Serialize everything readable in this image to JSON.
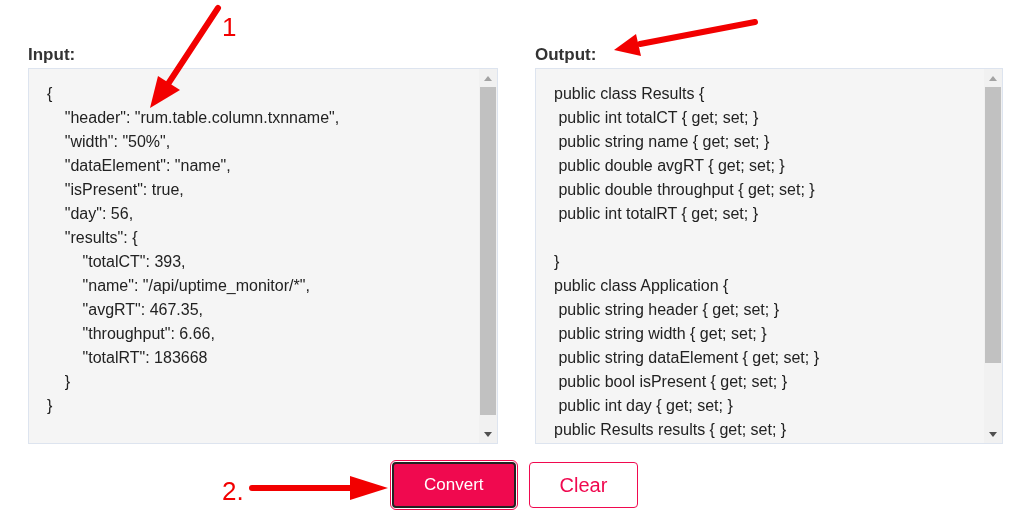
{
  "annotations": [
    {
      "kind": "arrow-number",
      "label": "1"
    },
    {
      "kind": "arrow"
    },
    {
      "kind": "arrow-number",
      "label": "2."
    }
  ],
  "input": {
    "label": "Input:",
    "value": "{\n    \"header\": \"rum.table.column.txnname\",\n    \"width\": \"50%\",\n    \"dataElement\": \"name\",\n    \"isPresent\": true,\n    \"day\": 56,\n    \"results\": {\n        \"totalCT\": 393,\n        \"name\": \"/api/uptime_monitor/*\",\n        \"avgRT\": 467.35,\n        \"throughput\": 6.66,\n        \"totalRT\": 183668\n    }\n}"
  },
  "output": {
    "label": "Output:",
    "value": "public class Results {\n public int totalCT { get; set; }\n public string name { get; set; }\n public double avgRT { get; set; }\n public double throughput { get; set; }\n public int totalRT { get; set; }\n\n}\npublic class Application {\n public string header { get; set; }\n public string width { get; set; }\n public string dataElement { get; set; }\n public bool isPresent { get; set; }\n public int day { get; set; }\npublic Results results { get; set; }"
  },
  "buttons": [
    {
      "label": "Convert",
      "kind": "primary"
    },
    {
      "label": "Clear",
      "kind": "outline"
    }
  ]
}
